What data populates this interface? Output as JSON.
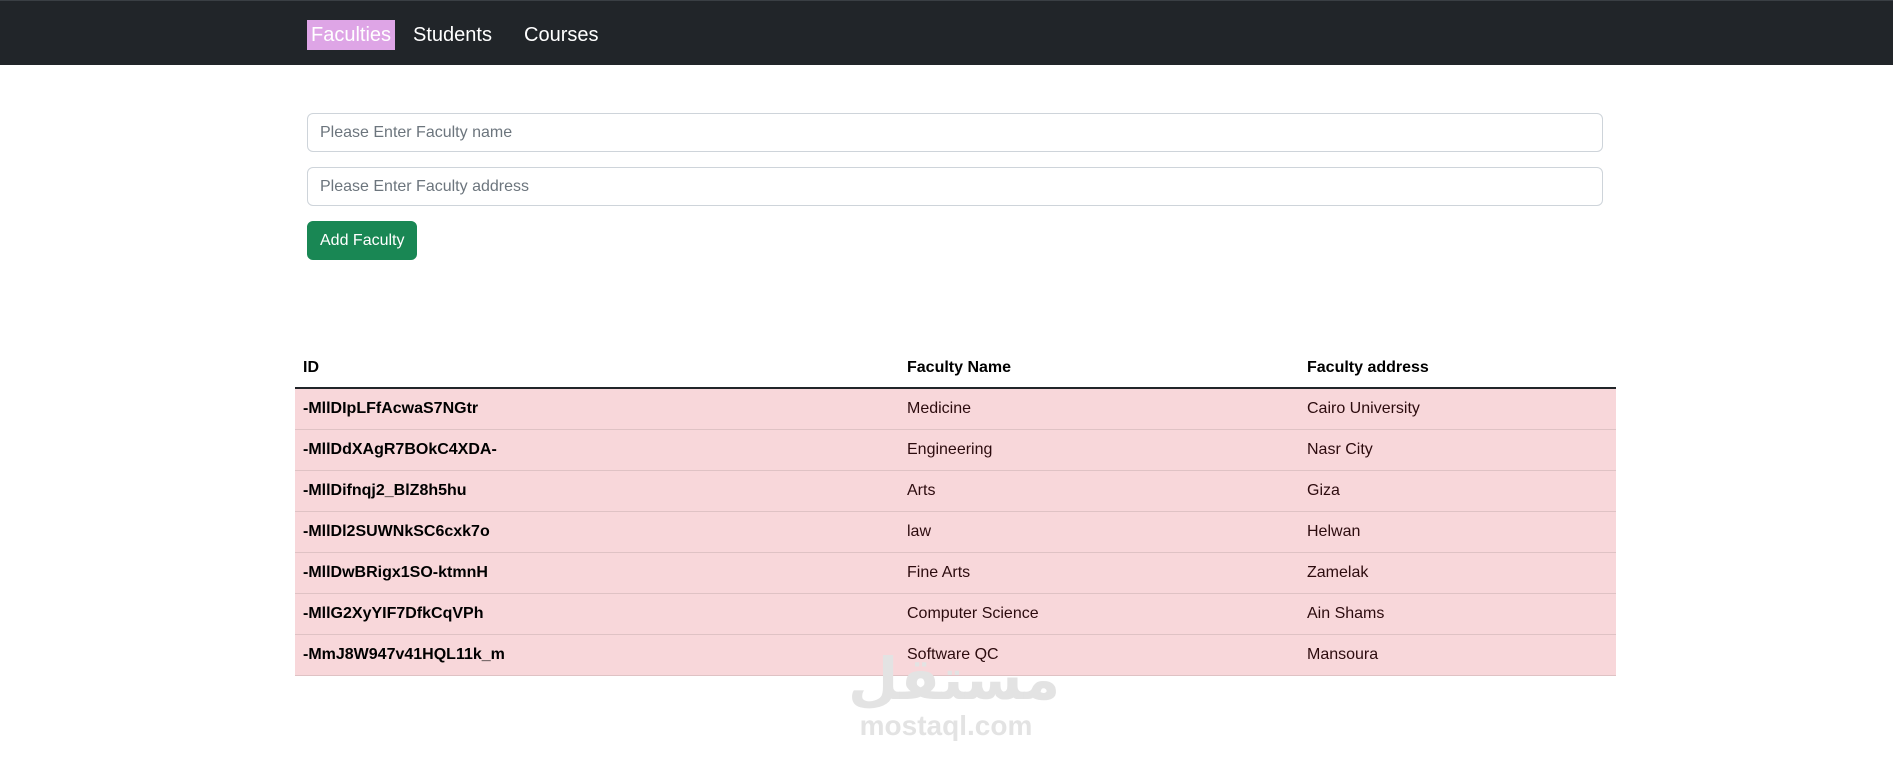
{
  "navbar": {
    "links": [
      {
        "label": "Faculties",
        "active": true
      },
      {
        "label": "Students",
        "active": false
      },
      {
        "label": "Courses",
        "active": false
      }
    ]
  },
  "form": {
    "name_placeholder": "Please Enter Faculty name",
    "name_value": "",
    "address_placeholder": "Please Enter Faculty address",
    "address_value": "",
    "submit_label": "Add Faculty"
  },
  "table": {
    "headers": [
      "ID",
      "Faculty Name",
      "Faculty address"
    ],
    "rows": [
      {
        "id": "-MllDIpLFfAcwaS7NGtr",
        "name": "Medicine",
        "address": "Cairo University"
      },
      {
        "id": "-MllDdXAgR7BOkC4XDA-",
        "name": "Engineering",
        "address": "Nasr City"
      },
      {
        "id": "-MllDifnqj2_BlZ8h5hu",
        "name": "Arts",
        "address": "Giza"
      },
      {
        "id": "-MllDl2SUWNkSC6cxk7o",
        "name": "law",
        "address": "Helwan"
      },
      {
        "id": "-MllDwBRigx1SO-ktmnH",
        "name": "Fine Arts",
        "address": "Zamelak"
      },
      {
        "id": "-MllG2XyYIF7DfkCqVPh",
        "name": "Computer Science",
        "address": "Ain Shams"
      },
      {
        "id": "-MmJ8W947v41HQL11k_m",
        "name": "Software QC",
        "address": "Mansoura"
      }
    ]
  },
  "watermark": {
    "arabic": "مستقل",
    "latin": "mostaql.com"
  },
  "colors": {
    "navbar_bg": "#212529",
    "active_nav_bg": "#dea5e6",
    "button_bg": "#198754",
    "row_bg": "#f8d7da"
  }
}
